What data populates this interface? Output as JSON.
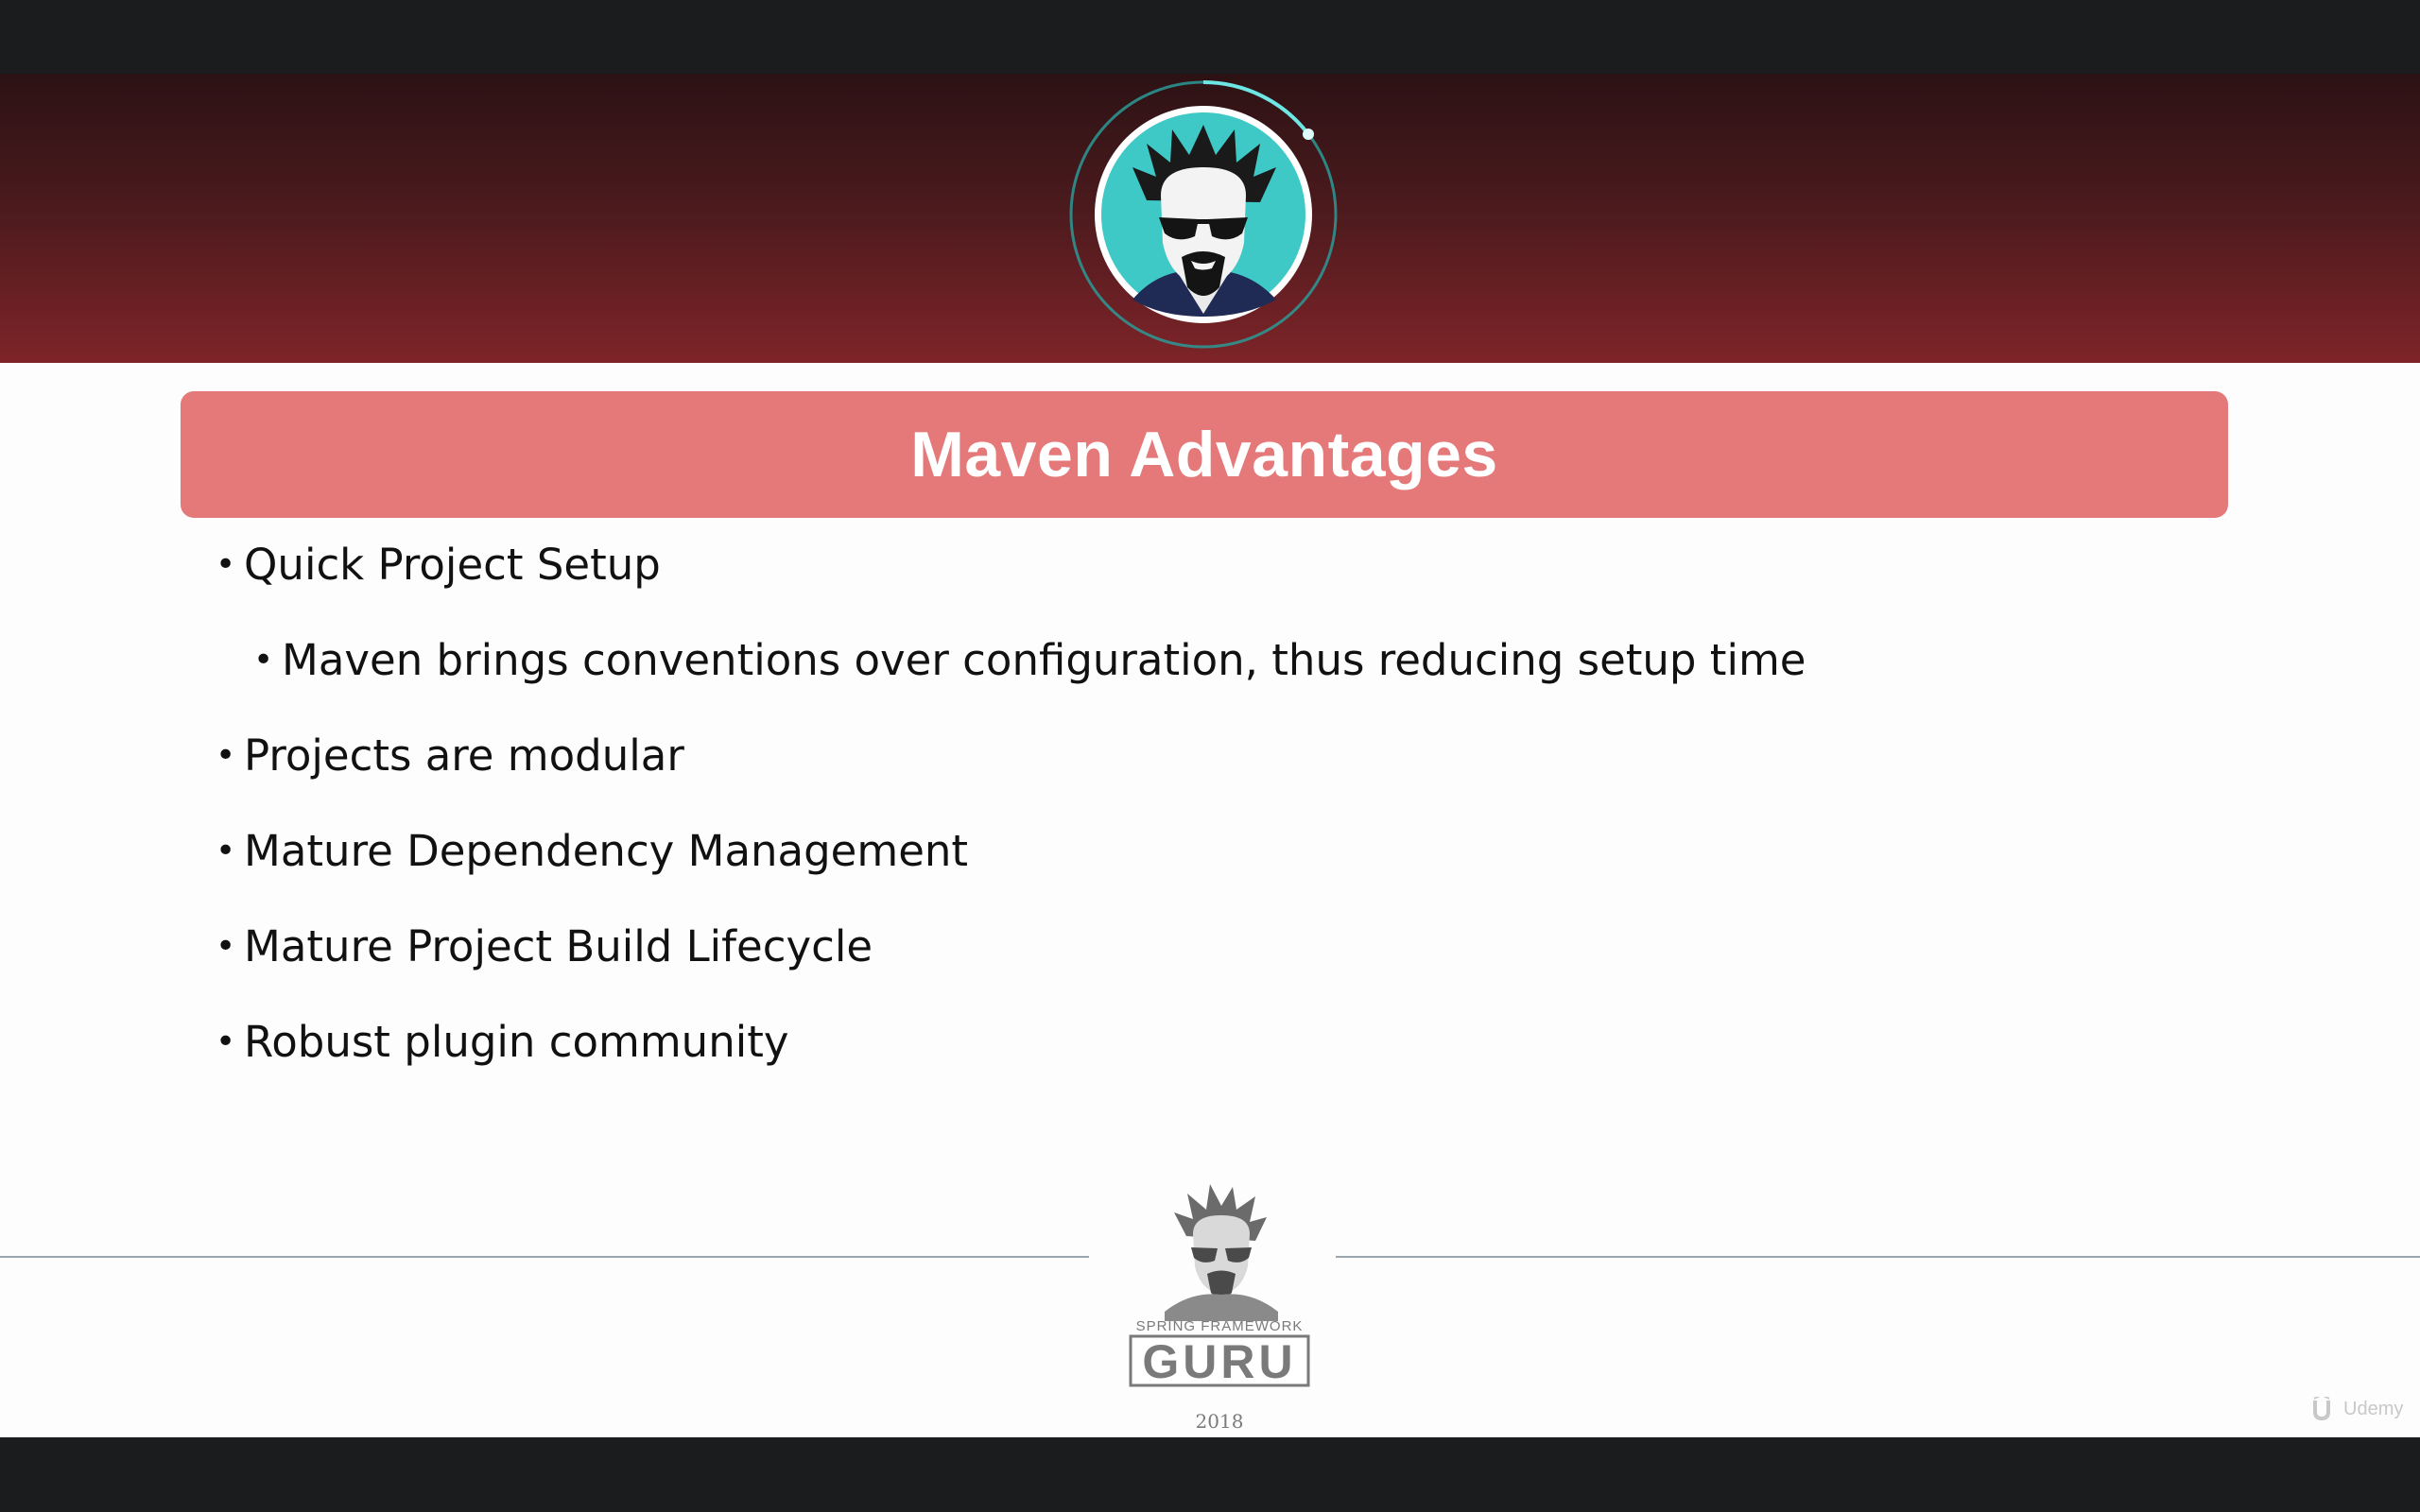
{
  "slide": {
    "title": "Maven Advantages",
    "bullets": [
      {
        "text": "Quick Project Setup",
        "level": 1
      },
      {
        "text": "Maven brings conventions over configuration, thus reducing setup time",
        "level": 2
      },
      {
        "text": "Projects are modular",
        "level": 1
      },
      {
        "text": "Mature Dependency Management",
        "level": 1
      },
      {
        "text": "Mature Project Build Lifecycle",
        "level": 1
      },
      {
        "text": "Robust plugin community",
        "level": 1
      }
    ],
    "bullet_glyph": "•"
  },
  "footer": {
    "logo_top_text": "SPRING FRAMEWORK",
    "logo_main_text": "GURU",
    "year": "2018"
  },
  "watermark": {
    "text": "Udemy"
  },
  "colors": {
    "banner_dark": "#2c1214",
    "banner_light": "#7e2428",
    "title_bar": "#e57878",
    "avatar_ring": "#2bb5b3",
    "avatar_bg": "#3ec9c7"
  }
}
